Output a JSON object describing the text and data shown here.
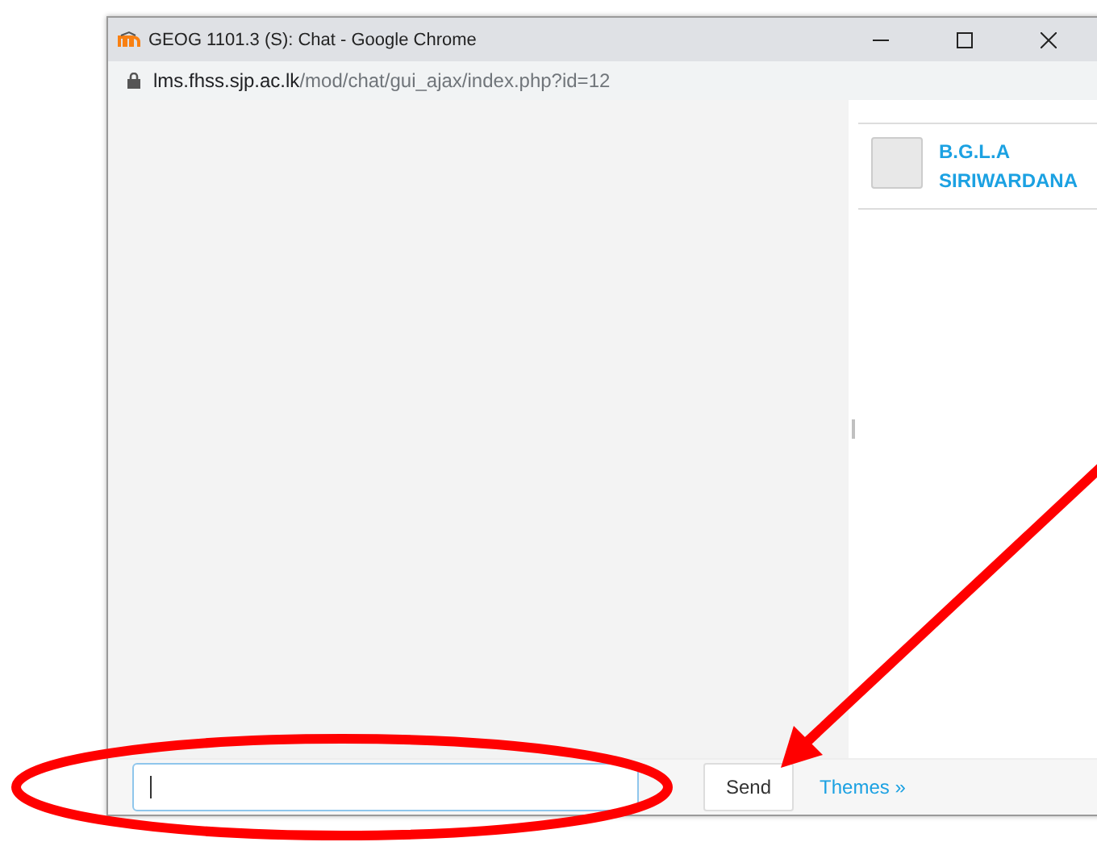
{
  "window": {
    "title": "GEOG 1101.3 (S): Chat - Google Chrome",
    "url_host": "lms.fhss.sjp.ac.lk",
    "url_path": "/mod/chat/gui_ajax/index.php?id=12"
  },
  "users": [
    {
      "name": "B.G.L.A SIRIWARDANA"
    }
  ],
  "send_button": "Send",
  "themes_link": "Themes »"
}
